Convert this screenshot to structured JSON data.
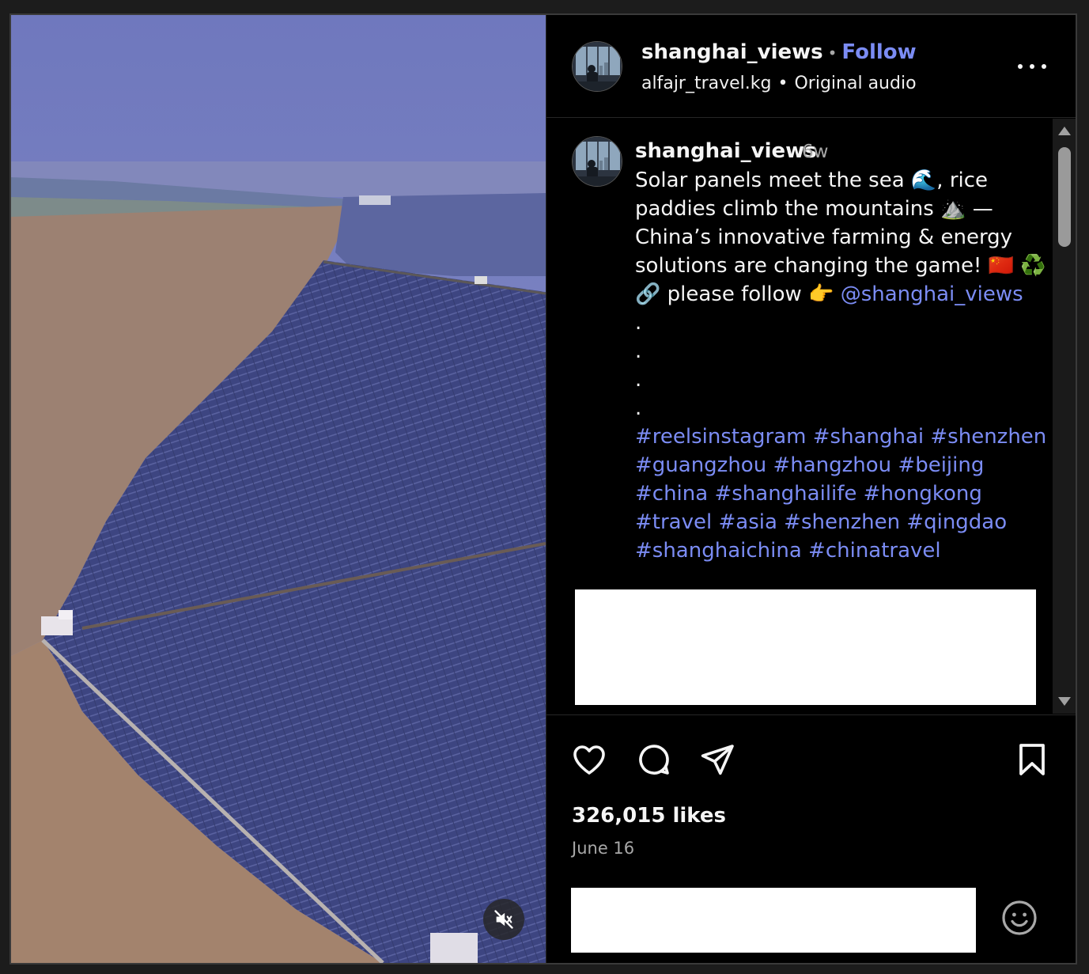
{
  "post": {
    "media_mute_icon": "speaker-muted-icon"
  },
  "header": {
    "username": "shanghai_views",
    "dot": "•",
    "follow_label": "Follow",
    "audio_user": "alfajr_travel.kg",
    "audio_sep": "•",
    "audio_label": "Original audio",
    "more_icon": "more-options-icon"
  },
  "caption": {
    "username": "shanghai_views",
    "time": "6w",
    "lines": [
      "Solar panels meet the sea 🌊, rice",
      "paddies climb the mountains ⛰️ —",
      "China’s innovative farming & energy",
      "solutions are changing the game! 🇨🇳 ♻️"
    ],
    "follow_prefix": "🔗 please follow 👉 ",
    "mention": "@shanghai_views",
    "dots": [
      ".",
      ".",
      ".",
      "."
    ],
    "hashtag_lines": [
      "#reelsinstagram #shanghai #shenzhen",
      "#guangzhou #hangzhou #beijing",
      "#china #shanghailife #hongkong",
      "#travel  #asia #shenzhen #qingdao",
      "#shanghaichina #chinatravel"
    ]
  },
  "actions": {
    "like_icon": "heart-icon",
    "comment_icon": "comment-icon",
    "share_icon": "share-icon",
    "save_icon": "bookmark-icon",
    "likes": "326,015 likes",
    "date": "June 16",
    "emoji_icon": "emoji-icon"
  },
  "colors": {
    "link_blue": "#7b8cf4",
    "muted_text": "#a8a8a8",
    "background": "#000000"
  }
}
